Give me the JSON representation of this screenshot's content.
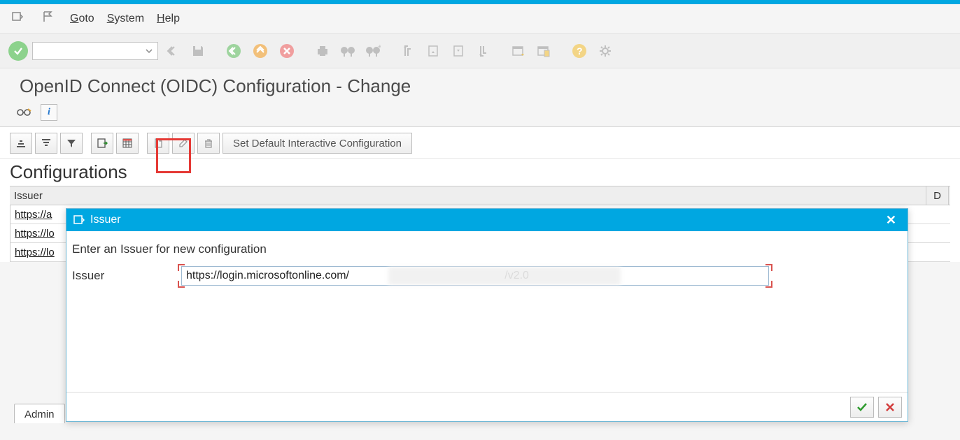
{
  "menu": {
    "goto": "Goto",
    "system": "System",
    "help": "Help"
  },
  "page_title": "OpenID Connect (OIDC) Configuration - Change",
  "toolbar2": {
    "default_btn": "Set Default Interactive Configuration"
  },
  "section_title": "Configurations",
  "table": {
    "header_issuer": "Issuer",
    "header_d": "D",
    "rows": [
      {
        "issuer": "https://a"
      },
      {
        "issuer": "https://lo"
      },
      {
        "issuer": "https://lo"
      }
    ]
  },
  "tabs": {
    "admin": "Admin"
  },
  "modal": {
    "title": "Issuer",
    "prompt": "Enter an Issuer for new configuration",
    "field_label": "Issuer",
    "field_value": "https://login.microsoftonline.com/                                                  /v2.0"
  }
}
